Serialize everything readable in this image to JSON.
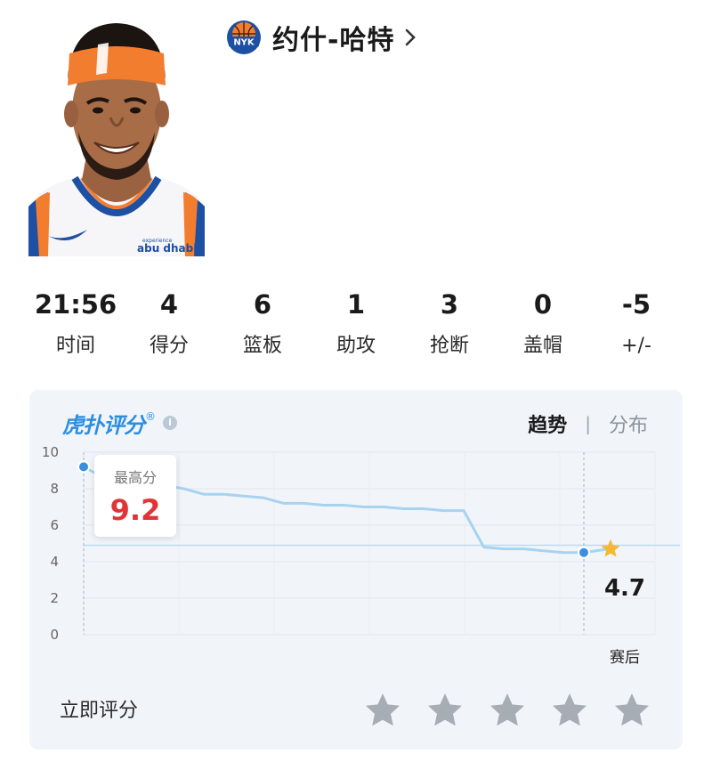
{
  "player": {
    "name": "约什-哈特",
    "team_logo_text": "NYK",
    "jersey_sponsor": "abu dhabi",
    "jersey_sponsor_small": "experience"
  },
  "stats": [
    {
      "value": "21:56",
      "label": "时间"
    },
    {
      "value": "4",
      "label": "得分"
    },
    {
      "value": "6",
      "label": "篮板"
    },
    {
      "value": "1",
      "label": "助攻"
    },
    {
      "value": "3",
      "label": "抢断"
    },
    {
      "value": "0",
      "label": "盖帽"
    },
    {
      "value": "-5",
      "label": "+/-"
    }
  ],
  "rating": {
    "brand": "虎扑评分",
    "brand_mark": "®",
    "info_icon": "i",
    "tabs": {
      "trend": "趋势",
      "separator": "|",
      "distribution": "分布"
    },
    "tooltip": {
      "label": "最高分",
      "value": "9.2"
    },
    "final_score": "4.7",
    "x_end_label": "赛后",
    "rate_now": "立即评分",
    "star_count": 5,
    "colors": {
      "line": "#a8d3f0",
      "dot": "#3a8fe0",
      "max": "#e03437",
      "star_gold": "#f5b82e",
      "star_empty": "#a7adb4"
    }
  },
  "chart_data": {
    "type": "line",
    "ylim": [
      0,
      10
    ],
    "yticks": [
      "0",
      "2",
      "4",
      "6",
      "8",
      "10"
    ],
    "average_line": 4.9,
    "series": [
      {
        "x": [
          0,
          1,
          2,
          3,
          4,
          5,
          6,
          7,
          8,
          9,
          10,
          11,
          12,
          13,
          14,
          15,
          16,
          17,
          18,
          19,
          20,
          21,
          22,
          23,
          24,
          25
        ],
        "values": [
          9.2,
          8.6,
          8.7,
          8.2,
          8.2,
          8.0,
          7.7,
          7.7,
          7.6,
          7.5,
          7.2,
          7.2,
          7.1,
          7.1,
          7.0,
          7.0,
          6.9,
          6.9,
          6.8,
          6.8,
          4.8,
          4.7,
          4.7,
          4.6,
          4.5,
          4.5
        ]
      }
    ],
    "marked_max": {
      "index": 0,
      "value": 9.2
    },
    "marked_final": {
      "value": 4.7
    }
  }
}
